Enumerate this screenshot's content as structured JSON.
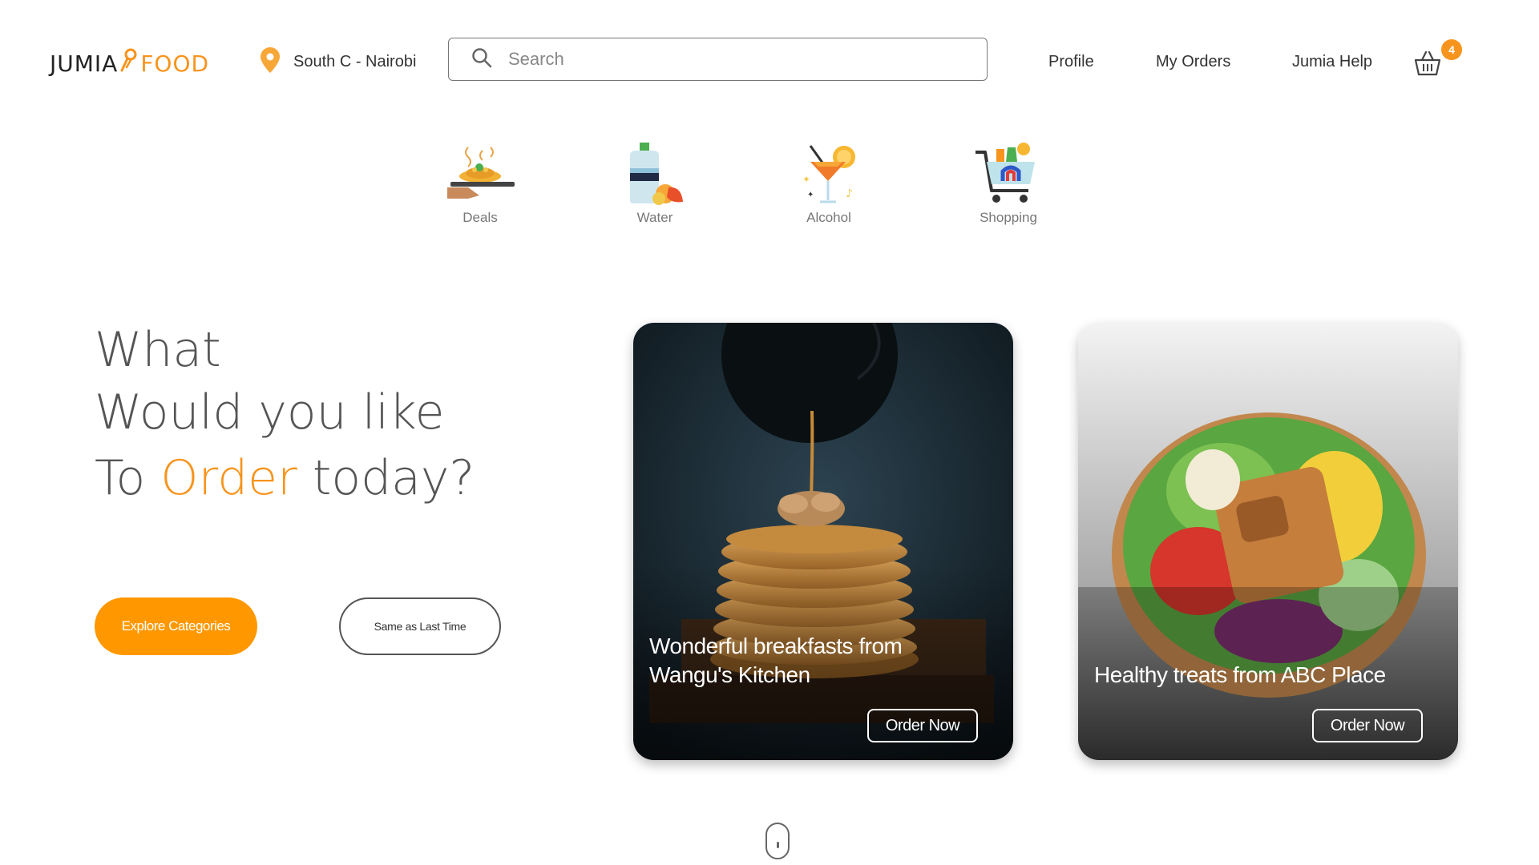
{
  "header": {
    "logo": {
      "brand": "JUMIA",
      "suffix": "FOOD",
      "logo_icon": "fork-rocket-icon"
    },
    "location": {
      "icon": "map-pin-icon",
      "text": "South C - Nairobi"
    },
    "search": {
      "icon": "search-icon",
      "placeholder": "Search",
      "value": ""
    },
    "nav": {
      "profile": "Profile",
      "my_orders": "My Orders",
      "help": "Jumia Help"
    },
    "cart": {
      "icon": "basket-icon",
      "count": "4"
    }
  },
  "categories": [
    {
      "label": "Deals",
      "icon": "food-plate-icon"
    },
    {
      "label": "Water",
      "icon": "water-bottle-icon"
    },
    {
      "label": "Alcohol",
      "icon": "cocktail-icon"
    },
    {
      "label": "Shopping",
      "icon": "shopping-cart-icon"
    }
  ],
  "hero": {
    "line1": "What",
    "line2": "Would you like",
    "line3_prefix": "To ",
    "line3_accent": "Order",
    "line3_suffix": " today?",
    "primary_button": "Explore Categories",
    "secondary_button": "Same as Last Time"
  },
  "cards": [
    {
      "title": "Wonderful breakfasts from Wangu's Kitchen",
      "button": "Order Now",
      "image": "pancakes-syrup-image"
    },
    {
      "title": "Healthy treats from ABC Place",
      "button": "Order Now",
      "image": "salad-bowl-image"
    }
  ],
  "scroll": {
    "icon": "mouse-scroll-icon"
  },
  "colors": {
    "accent": "#f7941d",
    "button_orange": "#ff9800",
    "text": "#555555"
  }
}
